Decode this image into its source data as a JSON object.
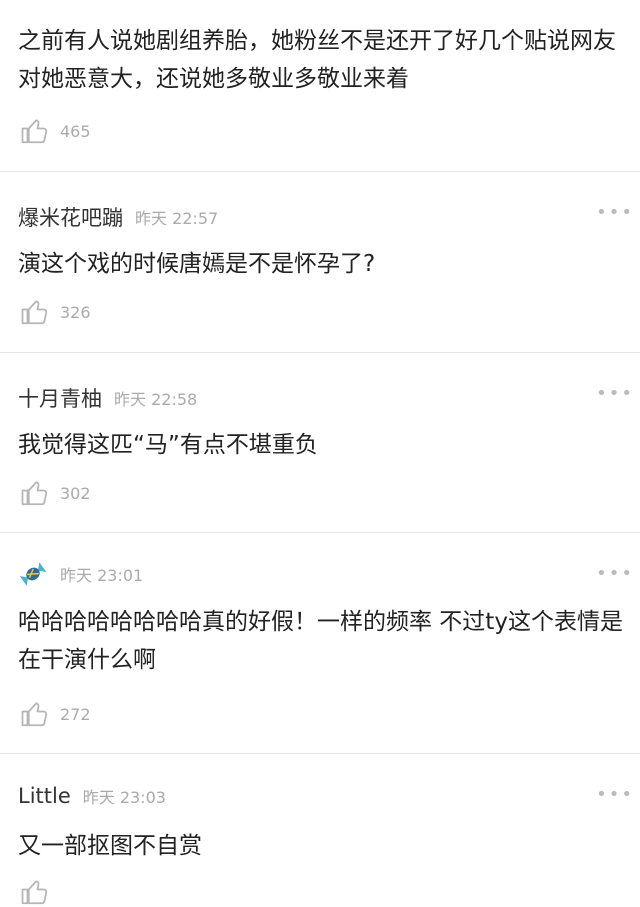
{
  "comments": [
    {
      "author": "",
      "time": "",
      "text": "之前有人说她剧组养胎，她粉丝不是还开了好几个贴说网友对她恶意大，还说她多敬业多敬业来着",
      "likes": "465"
    },
    {
      "author": "爆米花吧蹦",
      "time": "昨天 22:57",
      "text": "演这个戏的时候唐嫣是不是怀孕了?",
      "likes": "326"
    },
    {
      "author": "十月青柚",
      "time": "昨天 22:58",
      "text": "我觉得这匹“马”有点不堪重负",
      "likes": "302"
    },
    {
      "author": "",
      "time": "昨天 23:01",
      "text": "哈哈哈哈哈哈哈哈真的好假！一样的频率 不过ty这个表情是在干演什么啊",
      "likes": "272"
    },
    {
      "author": "Little",
      "time": "昨天 23:03",
      "text": "又一部抠图不自赏",
      "likes": ""
    }
  ],
  "icons": {
    "like": "thumbs-up-icon",
    "more": "more-dots-icon",
    "avatar": "candy-avatar-icon"
  },
  "colors": {
    "text": "#222222",
    "meta": "#aaaaaa",
    "divider": "#e6e6e6"
  }
}
